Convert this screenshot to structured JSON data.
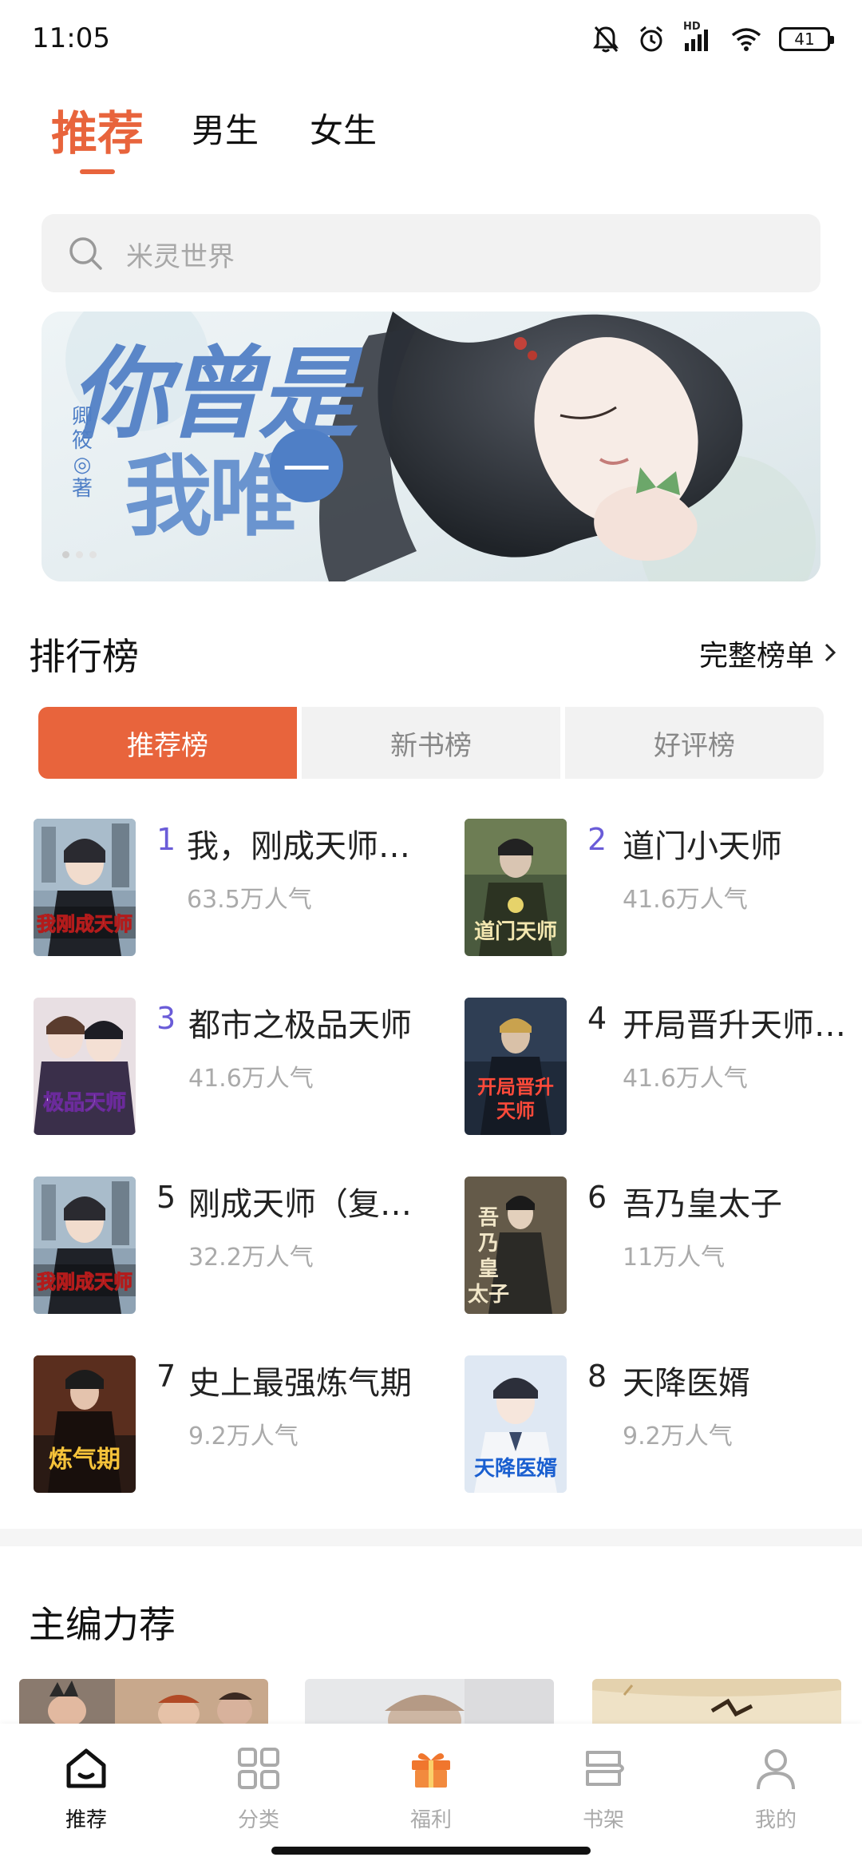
{
  "status_bar": {
    "time": "11:05",
    "battery": "41",
    "network_label": "HD"
  },
  "top_tabs": [
    {
      "label": "推荐",
      "active": true
    },
    {
      "label": "男生",
      "active": false
    },
    {
      "label": "女生",
      "active": false
    }
  ],
  "search": {
    "placeholder": "米灵世界"
  },
  "banner": {
    "title_line1": "你曾是",
    "title_line2": "我唯",
    "badge": "一",
    "author_chars": [
      "卿",
      "筱",
      "◎",
      "著"
    ],
    "dots_count": 3,
    "active_dot": 0
  },
  "ranking": {
    "title": "排行榜",
    "full_list_label": "完整榜单",
    "tabs": [
      {
        "label": "推荐榜",
        "active": true
      },
      {
        "label": "新书榜",
        "active": false
      },
      {
        "label": "好评榜",
        "active": false
      }
    ],
    "items": [
      {
        "rank": "1",
        "name": "我，刚成天师，…",
        "popularity": "63.5万人气",
        "cover_text": "我刚成天师"
      },
      {
        "rank": "2",
        "name": "道门小天师",
        "popularity": "41.6万人气",
        "cover_text": "道门天师"
      },
      {
        "rank": "3",
        "name": "都市之极品天师",
        "popularity": "41.6万人气",
        "cover_text": "极品天师"
      },
      {
        "rank": "4",
        "name": "开局晋升天师…",
        "popularity": "41.6万人气",
        "cover_text": "开局晋升天师"
      },
      {
        "rank": "5",
        "name": "刚成天师（复…",
        "popularity": "32.2万人气",
        "cover_text": "我刚成天师"
      },
      {
        "rank": "6",
        "name": "吾乃皇太子",
        "popularity": "11万人气",
        "cover_text": "吾乃皇太子"
      },
      {
        "rank": "7",
        "name": "史上最强炼气期",
        "popularity": "9.2万人气",
        "cover_text": "炼气期"
      },
      {
        "rank": "8",
        "name": "天降医婿",
        "popularity": "9.2万人气",
        "cover_text": "天降医婿"
      }
    ]
  },
  "editor_picks": {
    "title": "主编力荐"
  },
  "bottom_nav": [
    {
      "label": "推荐",
      "icon": "home-icon",
      "active": true
    },
    {
      "label": "分类",
      "icon": "grid-icon",
      "active": false
    },
    {
      "label": "福利",
      "icon": "gift-icon",
      "active": false
    },
    {
      "label": "书架",
      "icon": "bookshelf-icon",
      "active": false
    },
    {
      "label": "我的",
      "icon": "profile-icon",
      "active": false
    }
  ],
  "colors": {
    "accent": "#e8643c",
    "rank_top": "#6a5cd8",
    "muted": "#aaaaaa"
  }
}
